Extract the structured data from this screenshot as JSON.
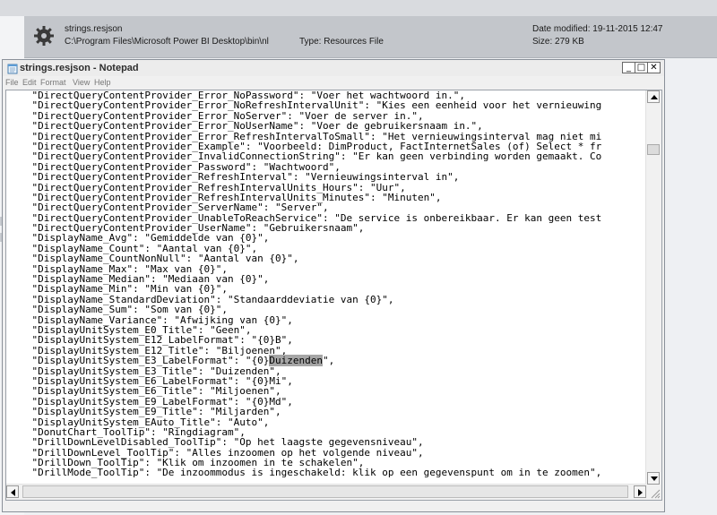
{
  "file_info": {
    "name": "strings.resjson",
    "path": "C:\\Program Files\\Microsoft Power BI Desktop\\bin\\nl",
    "type": "Type: Resources File",
    "date_modified": "Date modified: 19-11-2015 12:47",
    "size": "Size: 279 KB"
  },
  "window": {
    "title": "strings.resjson - Notepad",
    "controls": {
      "minimize": "_",
      "maximize": "□",
      "close": "✕"
    }
  },
  "menu": [
    "File",
    "Edit",
    "Format",
    "View",
    "Help"
  ],
  "editor": {
    "selected_text": "Duizenden",
    "lines": [
      "    \"DirectQueryContentProvider_Error_NoPassword\": \"Voer het wachtwoord in.\",",
      "    \"DirectQueryContentProvider_Error_NoRefreshIntervalUnit\": \"Kies een eenheid voor het vernieuwing",
      "    \"DirectQueryContentProvider_Error_NoServer\": \"Voer de server in.\",",
      "    \"DirectQueryContentProvider_Error_NoUserName\": \"Voer de gebruikersnaam in.\",",
      "    \"DirectQueryContentProvider_Error_RefreshIntervalToSmall\": \"Het vernieuwingsinterval mag niet mi",
      "    \"DirectQueryContentProvider_Example\": \"Voorbeeld: DimProduct, FactInternetSales (of) Select * fr",
      "    \"DirectQueryContentProvider_InvalidConnectionString\": \"Er kan geen verbinding worden gemaakt. Co",
      "    \"DirectQueryContentProvider_Password\": \"Wachtwoord\",",
      "    \"DirectQueryContentProvider_RefreshInterval\": \"Vernieuwingsinterval in\",",
      "    \"DirectQueryContentProvider_RefreshIntervalUnits_Hours\": \"Uur\",",
      "    \"DirectQueryContentProvider_RefreshIntervalUnits_Minutes\": \"Minuten\",",
      "    \"DirectQueryContentProvider_ServerName\": \"Server\",",
      "    \"DirectQueryContentProvider_UnableToReachService\": \"De service is onbereikbaar. Er kan geen test",
      "    \"DirectQueryContentProvider_UserName\": \"Gebruikersnaam\",",
      "    \"DisplayName_Avg\": \"Gemiddelde van {0}\",",
      "    \"DisplayName_Count\": \"Aantal van {0}\",",
      "    \"DisplayName_CountNonNull\": \"Aantal van {0}\",",
      "    \"DisplayName_Max\": \"Max van {0}\",",
      "    \"DisplayName_Median\": \"Mediaan van {0}\",",
      "    \"DisplayName_Min\": \"Min van {0}\",",
      "    \"DisplayName_StandardDeviation\": \"Standaarddeviatie van {0}\",",
      "    \"DisplayName_Sum\": \"Som van {0}\",",
      "    \"DisplayName_Variance\": \"Afwijking van {0}\",",
      "    \"DisplayUnitSystem_E0_Title\": \"Geen\",",
      "    \"DisplayUnitSystem_E12_LabelFormat\": \"{0}B\",",
      "    \"DisplayUnitSystem_E12_Title\": \"Biljoenen\",",
      "    \"DisplayUnitSystem_E3_LabelFormat\": \"{0}Duizenden\",",
      "    \"DisplayUnitSystem_E3_Title\": \"Duizenden\",",
      "    \"DisplayUnitSystem_E6_LabelFormat\": \"{0}Mi\",",
      "    \"DisplayUnitSystem_E6_Title\": \"Miljoenen\",",
      "    \"DisplayUnitSystem_E9_LabelFormat\": \"{0}Md\",",
      "    \"DisplayUnitSystem_E9_Title\": \"Miljarden\",",
      "    \"DisplayUnitSystem_EAuto_Title\": \"Auto\",",
      "    \"DonutChart_ToolTip\": \"Ringdiagram\",",
      "    \"DrillDownLevelDisabled_ToolTip\": \"Op het laagste gegevensniveau\",",
      "    \"DrillDownLevel_ToolTip\": \"Alles inzoomen op het volgende niveau\",",
      "    \"DrillDown_ToolTip\": \"Klik om inzoomen in te schakelen\",",
      "    \"DrillMode_ToolTip\": \"De inzoommodus is ingeschakeld: klik op een gegevenspunt om in te zoomen\","
    ]
  }
}
